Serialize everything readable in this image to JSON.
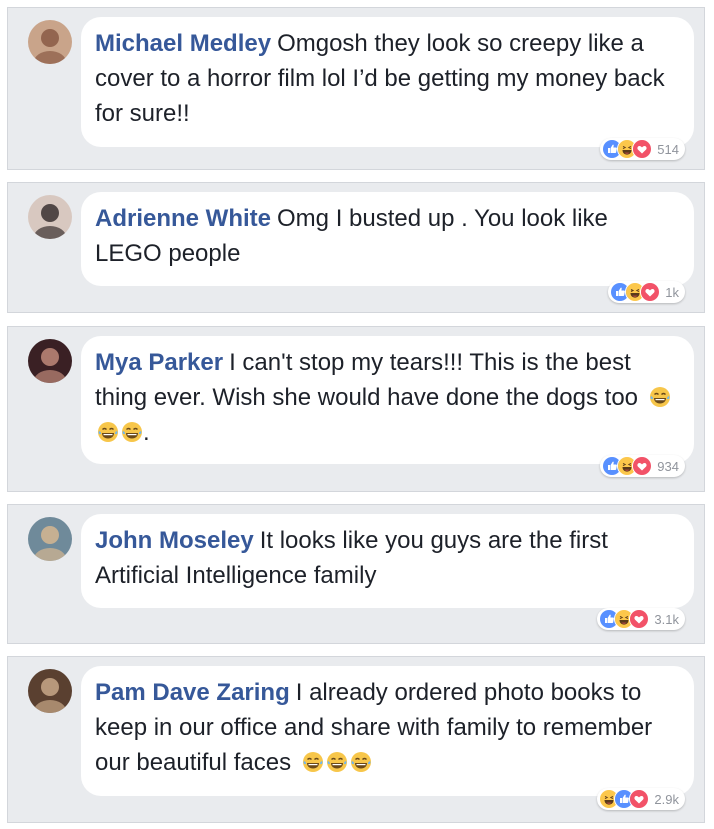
{
  "comments": [
    {
      "author": "Michael Medley",
      "text": "Omgosh they look so creepy like a cover to a horror film lol I’d be getting my money back for sure!!",
      "emoji_suffix": [],
      "reactions": [
        "like-icon",
        "haha-icon",
        "love-icon"
      ],
      "reaction_count": "514",
      "avatar_colors": [
        "#c9a48a",
        "#8a5a44"
      ]
    },
    {
      "author": "Adrienne White",
      "text": "Omg I busted up . You look like LEGO people",
      "emoji_suffix": [],
      "reactions": [
        "like-icon",
        "haha-icon",
        "love-icon"
      ],
      "reaction_count": "1k",
      "avatar_colors": [
        "#d8c8c0",
        "#3a3030"
      ]
    },
    {
      "author": "Mya Parker",
      "text": "I can't stop my tears!!! This is the best thing ever. Wish she would have done the dogs too",
      "emoji_suffix": [
        "joy-emoji",
        "joy-emoji",
        "joy-emoji"
      ],
      "text_after_emoji": ".",
      "reactions": [
        "like-icon",
        "haha-icon",
        "love-icon"
      ],
      "reaction_count": "934",
      "avatar_colors": [
        "#3a2024",
        "#c08a7a"
      ]
    },
    {
      "author": "John Moseley",
      "text": "It looks like you guys are the first Artificial Intelligence family",
      "emoji_suffix": [],
      "reactions": [
        "like-icon",
        "haha-icon",
        "love-icon"
      ],
      "reaction_count": "3.1k",
      "avatar_colors": [
        "#6f8a9a",
        "#d6b690"
      ]
    },
    {
      "author": "Pam Dave Zaring",
      "text": "I already ordered photo books to keep in our office and share with family to remember our beautiful faces",
      "emoji_suffix": [
        "joy-emoji",
        "joy-emoji",
        "joy-emoji"
      ],
      "reactions": [
        "haha-icon",
        "like-icon",
        "love-icon"
      ],
      "reaction_count": "2.9k",
      "avatar_colors": [
        "#5a4030",
        "#c8a888"
      ]
    }
  ],
  "colors": {
    "author_name": "#365899",
    "text": "#1d2129",
    "card_bg": "#e9ebee",
    "like_blue": "#5890ff",
    "love_red": "#f25268",
    "haha_yellow": "#fcc74b"
  }
}
